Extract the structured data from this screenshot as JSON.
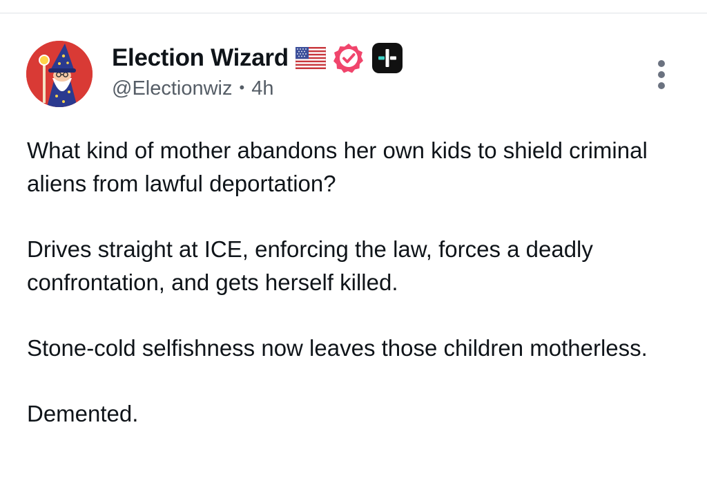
{
  "post": {
    "author": {
      "display_name": "Election Wizard",
      "handle": "@Electionwiz",
      "avatar_icon": "wizard-avatar-icon",
      "avatar_color": "#d93a35",
      "badges": [
        {
          "name": "us-flag-icon"
        },
        {
          "name": "verified-badge-icon",
          "color": "#f0456c"
        },
        {
          "name": "plus-subscriber-badge-icon",
          "color": "#111111"
        }
      ]
    },
    "separator": "•",
    "timestamp": "4h",
    "paragraphs": [
      "What kind of mother abandons her own kids to shield criminal aliens from lawful deportation?",
      "Drives straight at ICE, enforcing the law, forces a deadly confrontation, and gets herself killed.",
      "Stone-cold selfishness now leaves those children motherless.",
      "Demented."
    ],
    "menu_icon": "more-vertical-icon"
  },
  "colors": {
    "text_primary": "#0f1419",
    "text_secondary": "#555d66",
    "menu_dots": "#6b7280"
  }
}
